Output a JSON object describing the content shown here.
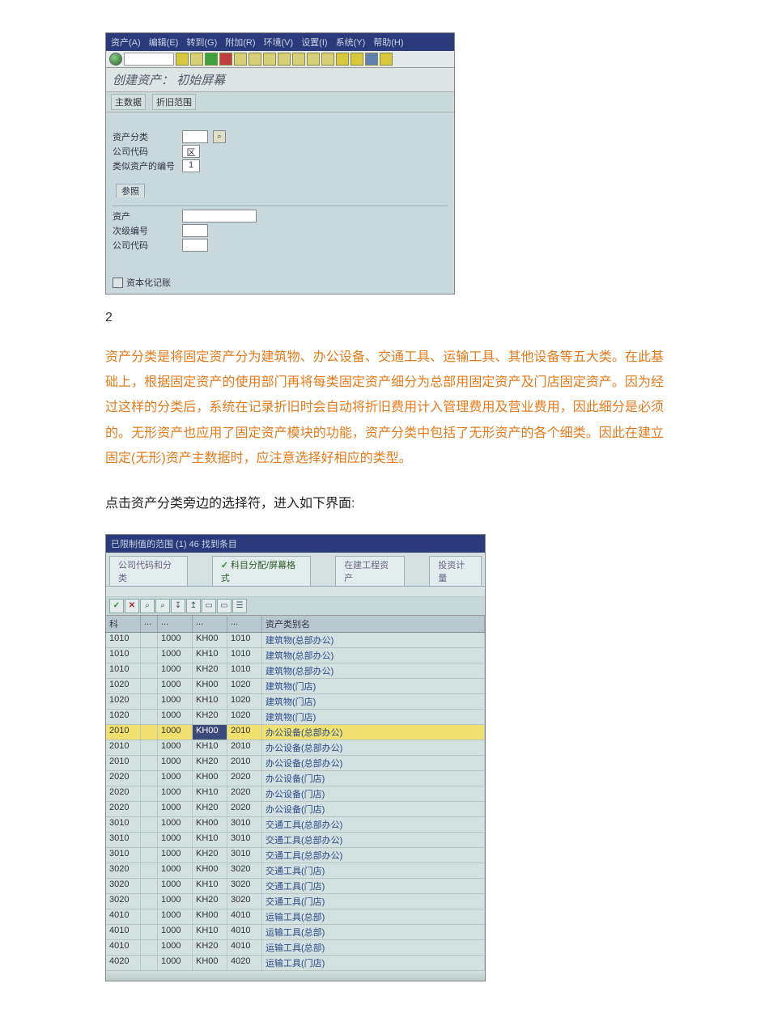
{
  "sap1": {
    "menubar": [
      "资产(A)",
      "编辑(E)",
      "转到(G)",
      "附加(R)",
      "环境(V)",
      "设置(I)",
      "系统(Y)",
      "帮助(H)"
    ],
    "title": "创建资产：  初始屏幕",
    "subbar": [
      "主数据",
      "折旧范围"
    ],
    "fields": {
      "asset_class_lbl": "资产分类",
      "company_code_lbl": "公司代码",
      "company_code_val": "区",
      "similar_num_lbl": "类似资产的编号",
      "similar_num_val": "1"
    },
    "group": {
      "tab": "参照",
      "asset_lbl": "资产",
      "subnum_lbl": "次级编号",
      "company_lbl": "公司代码"
    },
    "checkbox_lbl": "资本化记账"
  },
  "page_number": "2",
  "orange_text": "资产分类是将固定资产分为建筑物、办公设备、交通工具、运输工具、其他设备等五大类。在此基础上，根据固定资产的使用部门再将每类固定资产细分为总部用固定资产及门店固定资产。因为经过这样的分类后，系统在记录折旧时会自动将折旧费用计入管理费用及营业费用，因此细分是必须的。无形资产也应用了固定资产模块的功能，资产分类中包括了无形资产的各个细类。因此在建立固定(无形)资产主数据时，应注意选择好相应的类型。",
  "black_text": "点击资产分类旁边的选择符，进入如下界面:",
  "sap2": {
    "titlebar": "已限制值的范围 (1)    46 找到条目",
    "tabs": [
      {
        "label": "公司代码和分类",
        "active": false,
        "check": false
      },
      {
        "label": "科目分配/屏幕格式",
        "active": true,
        "check": true
      },
      {
        "label": "在建工程资产",
        "active": false,
        "check": false
      },
      {
        "label": "投资计量",
        "active": false,
        "check": false
      }
    ],
    "header": {
      "k": "科",
      "dots": "...",
      "name": "资产类别名"
    },
    "rows": [
      {
        "k": "1010",
        "c1": "1000",
        "c2": "KH00",
        "c3": "1010",
        "name": "建筑物(总部办公)",
        "sel": false
      },
      {
        "k": "1010",
        "c1": "1000",
        "c2": "KH10",
        "c3": "1010",
        "name": "建筑物(总部办公)",
        "sel": false
      },
      {
        "k": "1010",
        "c1": "1000",
        "c2": "KH20",
        "c3": "1010",
        "name": "建筑物(总部办公)",
        "sel": false
      },
      {
        "k": "1020",
        "c1": "1000",
        "c2": "KH00",
        "c3": "1020",
        "name": "建筑物(门店)",
        "sel": false
      },
      {
        "k": "1020",
        "c1": "1000",
        "c2": "KH10",
        "c3": "1020",
        "name": "建筑物(门店)",
        "sel": false
      },
      {
        "k": "1020",
        "c1": "1000",
        "c2": "KH20",
        "c3": "1020",
        "name": "建筑物(门店)",
        "sel": false
      },
      {
        "k": "2010",
        "c1": "1000",
        "c2": "KH00",
        "c3": "2010",
        "name": "办公设备(总部办公)",
        "sel": true
      },
      {
        "k": "2010",
        "c1": "1000",
        "c2": "KH10",
        "c3": "2010",
        "name": "办公设备(总部办公)",
        "sel": false
      },
      {
        "k": "2010",
        "c1": "1000",
        "c2": "KH20",
        "c3": "2010",
        "name": "办公设备(总部办公)",
        "sel": false
      },
      {
        "k": "2020",
        "c1": "1000",
        "c2": "KH00",
        "c3": "2020",
        "name": "办公设备(门店)",
        "sel": false
      },
      {
        "k": "2020",
        "c1": "1000",
        "c2": "KH10",
        "c3": "2020",
        "name": "办公设备(门店)",
        "sel": false
      },
      {
        "k": "2020",
        "c1": "1000",
        "c2": "KH20",
        "c3": "2020",
        "name": "办公设备(门店)",
        "sel": false
      },
      {
        "k": "3010",
        "c1": "1000",
        "c2": "KH00",
        "c3": "3010",
        "name": "交通工具(总部办公)",
        "sel": false
      },
      {
        "k": "3010",
        "c1": "1000",
        "c2": "KH10",
        "c3": "3010",
        "name": "交通工具(总部办公)",
        "sel": false
      },
      {
        "k": "3010",
        "c1": "1000",
        "c2": "KH20",
        "c3": "3010",
        "name": "交通工具(总部办公)",
        "sel": false
      },
      {
        "k": "3020",
        "c1": "1000",
        "c2": "KH00",
        "c3": "3020",
        "name": "交通工具(门店)",
        "sel": false
      },
      {
        "k": "3020",
        "c1": "1000",
        "c2": "KH10",
        "c3": "3020",
        "name": "交通工具(门店)",
        "sel": false
      },
      {
        "k": "3020",
        "c1": "1000",
        "c2": "KH20",
        "c3": "3020",
        "name": "交通工具(门店)",
        "sel": false
      },
      {
        "k": "4010",
        "c1": "1000",
        "c2": "KH00",
        "c3": "4010",
        "name": "运输工具(总部)",
        "sel": false
      },
      {
        "k": "4010",
        "c1": "1000",
        "c2": "KH10",
        "c3": "4010",
        "name": "运输工具(总部)",
        "sel": false
      },
      {
        "k": "4010",
        "c1": "1000",
        "c2": "KH20",
        "c3": "4010",
        "name": "运输工具(总部)",
        "sel": false
      },
      {
        "k": "4020",
        "c1": "1000",
        "c2": "KH00",
        "c3": "4020",
        "name": "运输工具(门店)",
        "sel": false
      }
    ]
  }
}
